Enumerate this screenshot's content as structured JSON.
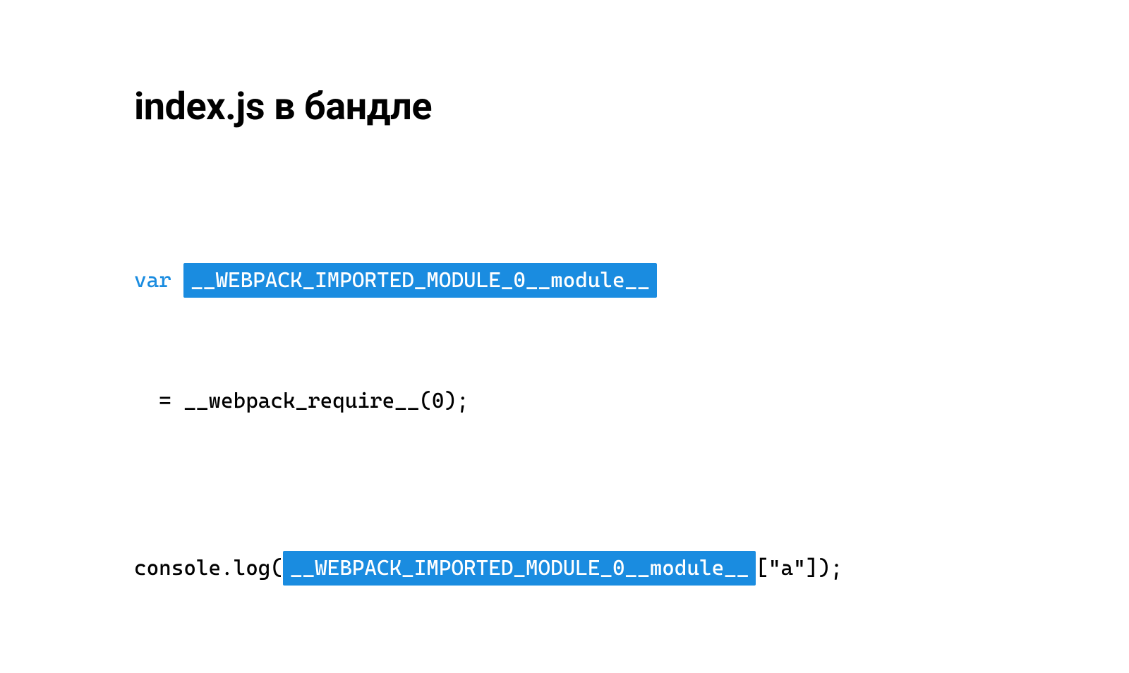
{
  "title": "index.js в бандле",
  "code": {
    "line1": {
      "keyword": "var",
      "hl": "__WEBPACK_IMPORTED_MODULE_0__module__"
    },
    "line2": {
      "indent": "  ",
      "rest": "= __webpack_require__(0);"
    },
    "line3": {
      "prefix": "console.log(",
      "hl": "__WEBPACK_IMPORTED_MODULE_0__module__",
      "suffix": "[\"a\"]);"
    }
  }
}
